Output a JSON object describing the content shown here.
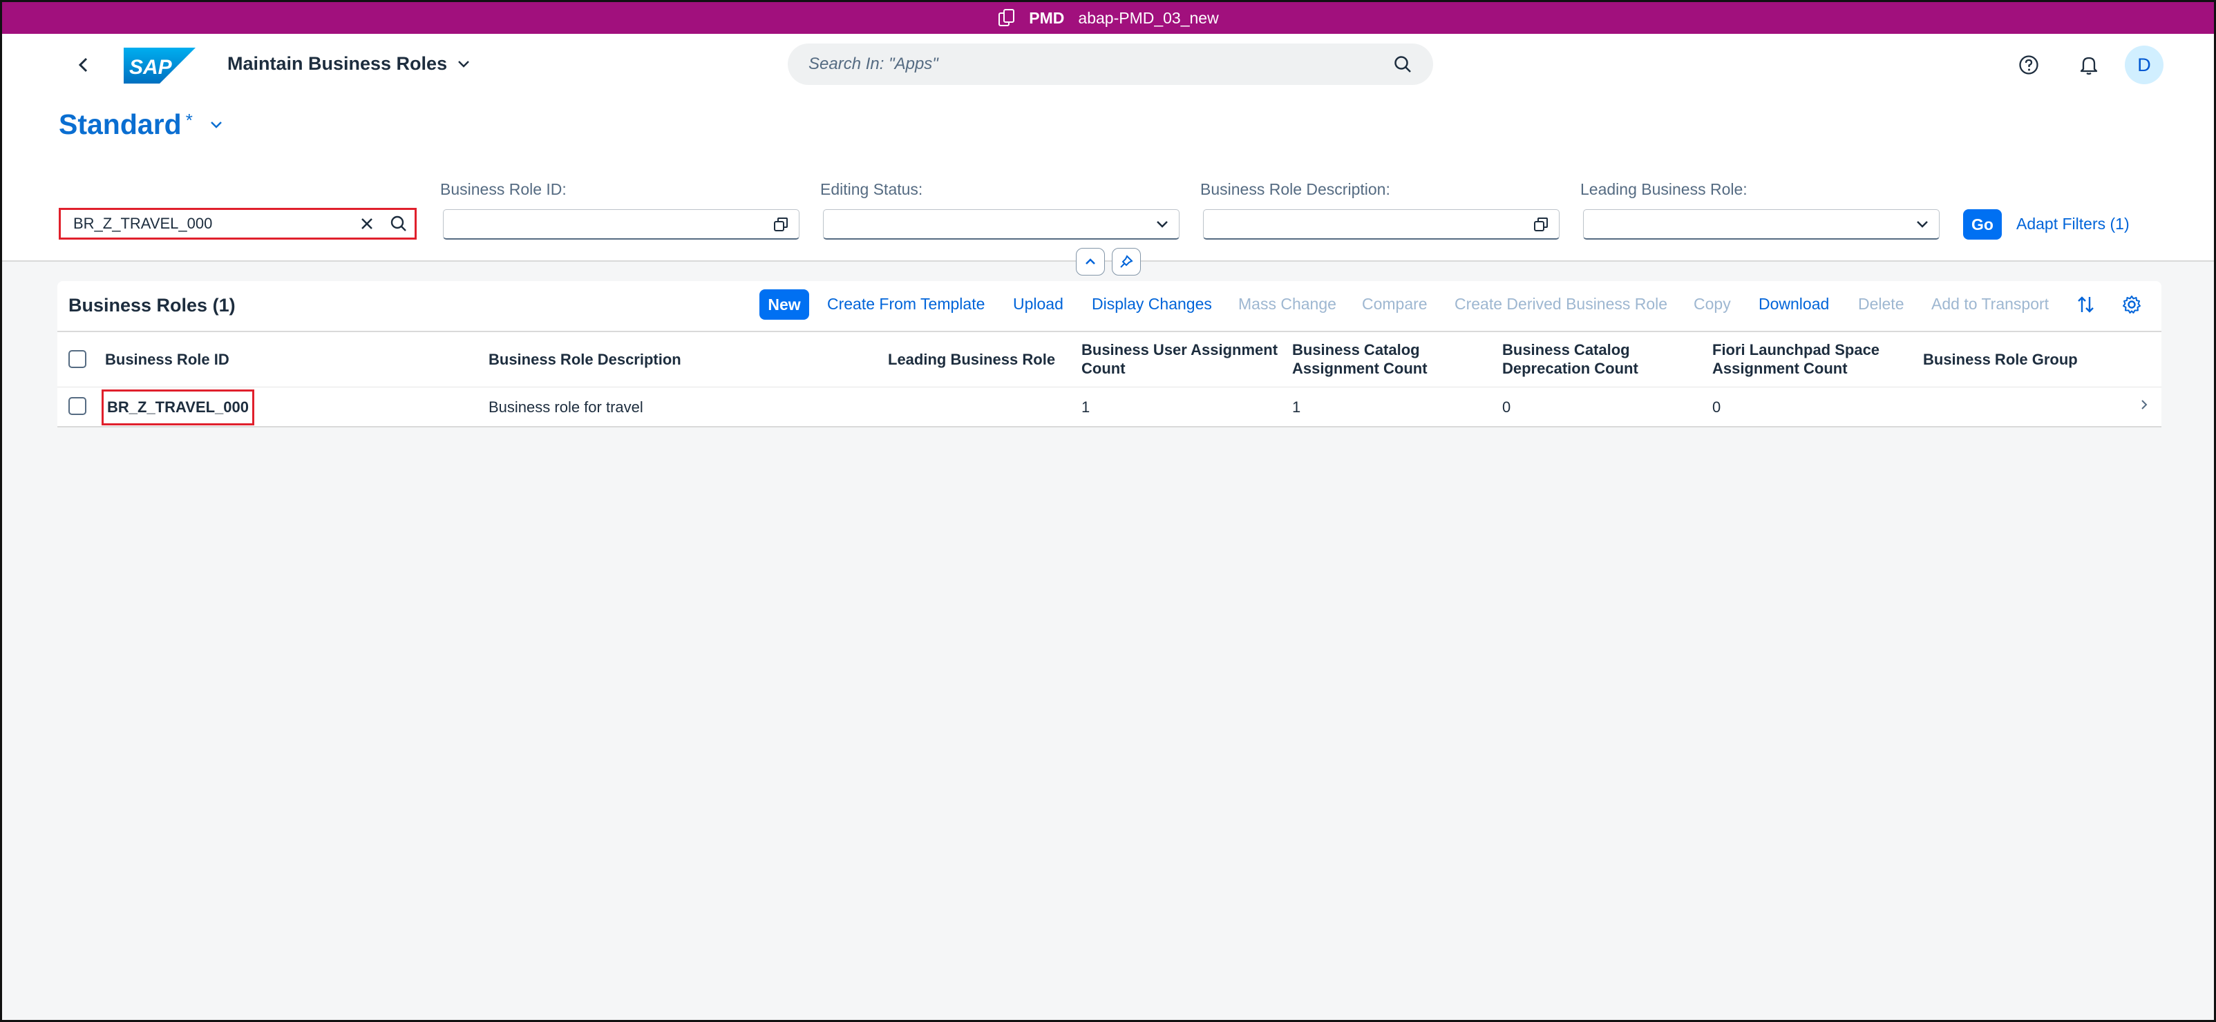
{
  "system_bar": {
    "system": "PMD",
    "client": "abap-PMD_03_new"
  },
  "shell": {
    "app_title": "Maintain Business Roles",
    "search_placeholder": "Search In: \"Apps\"",
    "avatar_initial": "D"
  },
  "variant": {
    "name": "Standard",
    "modified_marker": "*"
  },
  "filters": {
    "search_value": "BR_Z_TRAVEL_000",
    "fields": [
      {
        "label": "Business Role ID:",
        "value": "",
        "type": "value-help"
      },
      {
        "label": "Editing Status:",
        "value": "",
        "type": "dropdown"
      },
      {
        "label": "Business Role Description:",
        "value": "",
        "type": "value-help"
      },
      {
        "label": "Leading Business Role:",
        "value": "",
        "type": "dropdown"
      }
    ],
    "go_label": "Go",
    "adapt_label": "Adapt Filters (1)"
  },
  "table": {
    "title": "Business Roles (1)",
    "toolbar": [
      {
        "label": "New",
        "state": "emphasized"
      },
      {
        "label": "Create From Template",
        "state": "enabled"
      },
      {
        "label": "Upload",
        "state": "enabled"
      },
      {
        "label": "Display Changes",
        "state": "enabled"
      },
      {
        "label": "Mass Change",
        "state": "disabled"
      },
      {
        "label": "Compare",
        "state": "disabled"
      },
      {
        "label": "Create Derived Business Role",
        "state": "disabled"
      },
      {
        "label": "Copy",
        "state": "disabled"
      },
      {
        "label": "Download",
        "state": "enabled"
      },
      {
        "label": "Delete",
        "state": "disabled"
      },
      {
        "label": "Add to Transport",
        "state": "disabled"
      }
    ],
    "columns": [
      [
        "Business Role ID"
      ],
      [
        "Business Role Description"
      ],
      [
        "Leading Business Role"
      ],
      [
        "Business User Assignment",
        "Count"
      ],
      [
        "Business Catalog",
        "Assignment Count"
      ],
      [
        "Business Catalog",
        "Deprecation Count"
      ],
      [
        "Fiori Launchpad Space",
        "Assignment Count"
      ],
      [
        "Business Role Group"
      ]
    ],
    "rows": [
      {
        "id": "BR_Z_TRAVEL_000",
        "description": "Business role for travel",
        "leading_role": "",
        "user_assignment_count": "1",
        "catalog_assignment_count": "1",
        "catalog_deprecation_count": "0",
        "space_assignment_count": "0",
        "group": ""
      }
    ]
  },
  "colors": {
    "system_bar": "#a1107d",
    "accent": "#0070f2",
    "link": "#0064d9",
    "highlight_box": "#e0202c"
  }
}
